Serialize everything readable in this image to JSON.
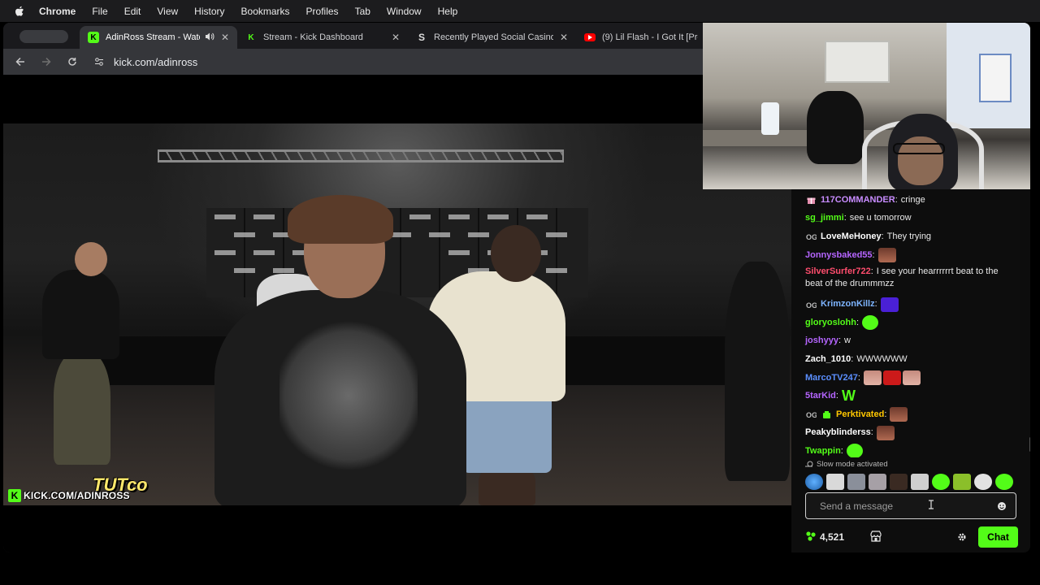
{
  "menubar": {
    "app": "Chrome",
    "items": [
      "File",
      "Edit",
      "View",
      "History",
      "Bookmarks",
      "Profiles",
      "Tab",
      "Window",
      "Help"
    ]
  },
  "tabs": [
    {
      "title": "AdinRoss Stream - Watch",
      "favicon": "kick-logo-icon",
      "active": true,
      "audio": true
    },
    {
      "title": "Stream - Kick Dashboard",
      "favicon": "kick-logo-icon",
      "active": false
    },
    {
      "title": "Recently Played Social Casino",
      "favicon": "stake-s-icon",
      "active": false
    },
    {
      "title": "(9) Lil Flash - I Got It [Prod",
      "favicon": "youtube-icon",
      "active": false
    }
  ],
  "address": {
    "url": "kick.com/adinross"
  },
  "video": {
    "watermark_url": "KICK.COM/ADINROSS",
    "watermark_tag": "TUTco"
  },
  "chat": {
    "messages": [
      {
        "user": "117COMMANDER",
        "color": "#c88cff",
        "badge": "gift",
        "text": "cringe"
      },
      {
        "user": "sg_jimmi",
        "color": "#53fc18",
        "text": "see u tomorrow"
      },
      {
        "user": "LoveMeHoney",
        "color": "#ffffff",
        "badge": "og",
        "text": "They trying"
      },
      {
        "user": "Jonnysbaked55",
        "color": "#b565ff",
        "emotes": [
          "face"
        ]
      },
      {
        "user": "SilverSurfer722",
        "color": "#ff4d6d",
        "text": "I see your hearrrrrrt beat to the beat of the drummmzz"
      },
      {
        "user": "KrimzonKillz",
        "color": "#7db4ff",
        "badge": "og",
        "emotes": [
          "purple"
        ]
      },
      {
        "user": "gloryoslohh",
        "color": "#53fc18",
        "emotes": [
          "green"
        ]
      },
      {
        "user": "joshyyy",
        "color": "#b565ff",
        "text": "w"
      },
      {
        "user": "Zach_1010",
        "color": "#ffffff",
        "text": "WWWWWW"
      },
      {
        "user": "MarcoTV247",
        "color": "#5b8fff",
        "emotes": [
          "pink",
          "red",
          "pink"
        ]
      },
      {
        "user": "5tarKid",
        "color": "#b565ff",
        "text": "W"
      },
      {
        "user": "Perktivated",
        "color": "#ffc700",
        "badge": "og",
        "badge2": "sub",
        "emotes": [
          "face"
        ]
      },
      {
        "user": "Peakyblinderss",
        "color": "#ffffff",
        "emotes": [
          "face"
        ]
      },
      {
        "user": "Twappin",
        "color": "#53fc18",
        "emotes": [
          "green"
        ]
      }
    ],
    "slow_mode": "Slow mode activated",
    "input_placeholder": "Send a message",
    "points": "4,521",
    "chat_button": "Chat",
    "accent": "#53fc18"
  }
}
